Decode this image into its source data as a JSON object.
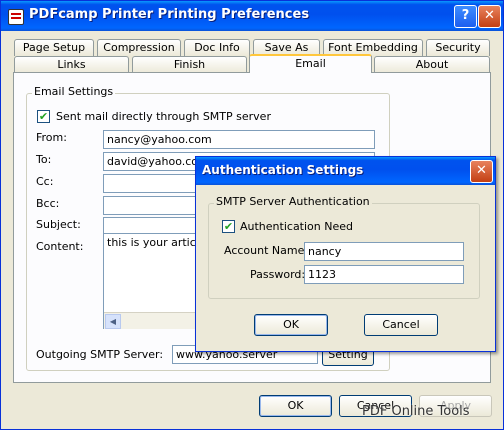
{
  "window": {
    "title": "PDFcamp Printer Printing Preferences",
    "help_glyph": "?",
    "close_glyph": "✕"
  },
  "tabs_row1": [
    "Page Setup",
    "Compression",
    "Doc Info",
    "Save As",
    "Font Embedding",
    "Security"
  ],
  "tabs_row2": [
    "Links",
    "Finish",
    "Email",
    "About"
  ],
  "active_tab": "Email",
  "email": {
    "group_label": "Email Settings",
    "smtp_direct_label": "Sent mail directly through SMTP server",
    "smtp_direct_checked": true,
    "from_label": "From:",
    "from_value": "nancy@yahoo.com",
    "to_label": "To:",
    "to_value": "david@yahoo.com",
    "cc_label": "Cc:",
    "cc_value": "",
    "bcc_label": "Bcc:",
    "bcc_value": "",
    "subject_label": "Subject:",
    "subject_value": "",
    "content_label": "Content:",
    "content_value": "this is your article.",
    "smtp_server_label": "Outgoing SMTP Server:",
    "smtp_server_value": "www.yahoo.server",
    "setting_button": "Setting"
  },
  "dialog": {
    "title": "Authentication Settings",
    "close_glyph": "✕",
    "group_label": "SMTP Server Authentication",
    "auth_need_label": "Authentication Need",
    "auth_need_checked": true,
    "account_label": "Account Name:",
    "account_value": "nancy",
    "password_label": "Password:",
    "password_value": "1123",
    "ok_button": "OK",
    "cancel_button": "Cancel"
  },
  "footer": {
    "ok_button": "OK",
    "cancel_button": "Cancel",
    "apply_button": "Apply"
  },
  "watermark": "PDF Online Tools",
  "check_glyph": "✔"
}
